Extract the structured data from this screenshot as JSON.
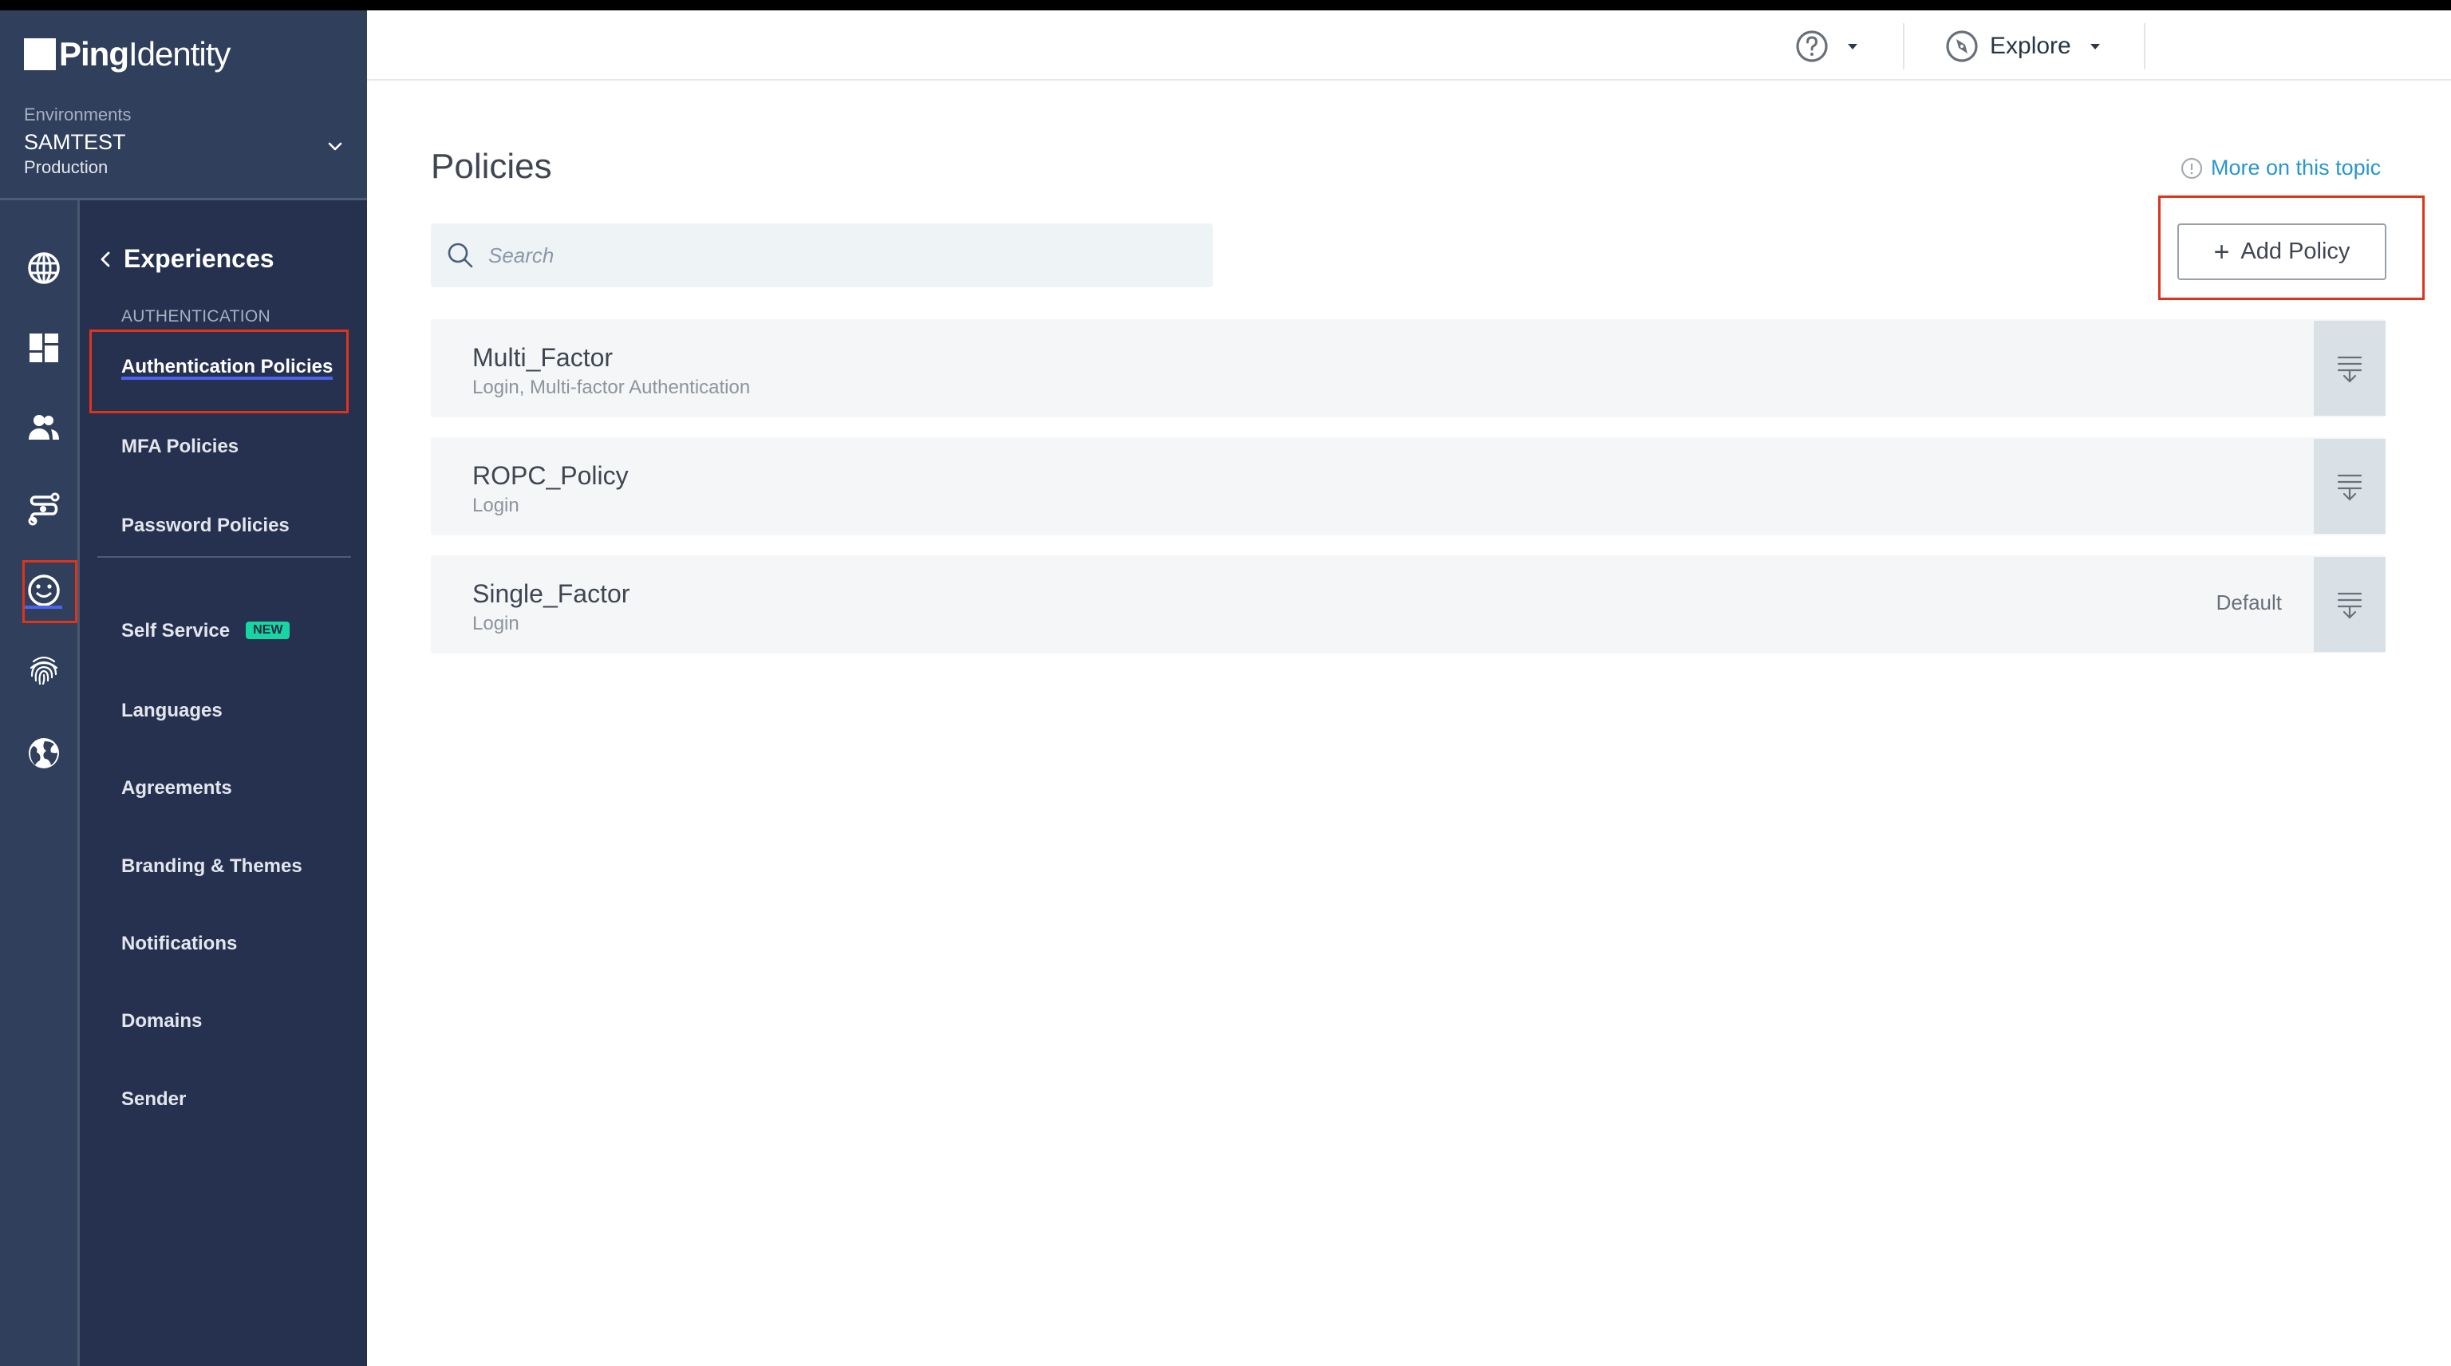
{
  "app": {
    "brand_bold": "Ping",
    "brand_light": "Identity",
    "brand_suffix": "."
  },
  "environment": {
    "label": "Environments",
    "name": "SAMTEST",
    "type": "Production"
  },
  "icon_strip": [
    {
      "name": "globe-icon",
      "label": "Overview"
    },
    {
      "name": "dashboard-icon",
      "label": "Dashboard"
    },
    {
      "name": "users-icon",
      "label": "Identities"
    },
    {
      "name": "connections-icon",
      "label": "Connections"
    },
    {
      "name": "smiley-icon",
      "label": "Experiences",
      "active": true
    },
    {
      "name": "fingerprint-icon",
      "label": "Threat Protection"
    },
    {
      "name": "earth-icon",
      "label": "Settings"
    }
  ],
  "nav": {
    "back_label": "Experiences",
    "section_label": "AUTHENTICATION",
    "items": [
      {
        "label": "Authentication Policies",
        "active": true
      },
      {
        "label": "MFA Policies"
      },
      {
        "label": "Password Policies"
      },
      {
        "label": "Self Service",
        "badge": "NEW"
      },
      {
        "label": "Languages"
      },
      {
        "label": "Agreements"
      },
      {
        "label": "Branding & Themes"
      },
      {
        "label": "Notifications"
      },
      {
        "label": "Domains"
      },
      {
        "label": "Sender"
      }
    ]
  },
  "header": {
    "help_icon": "question-circle-icon",
    "explore_label": "Explore",
    "explore_icon": "compass-icon"
  },
  "main": {
    "title": "Policies",
    "help_link": "More on this topic",
    "search_placeholder": "Search",
    "search_value": "",
    "add_button": "Add Policy",
    "add_button_icon": "+",
    "policies": [
      {
        "name": "Multi_Factor",
        "description": "Login, Multi-factor Authentication",
        "default_label": ""
      },
      {
        "name": "ROPC_Policy",
        "description": "Login",
        "default_label": ""
      },
      {
        "name": "Single_Factor",
        "description": "Login",
        "default_label": "Default"
      }
    ]
  },
  "colors": {
    "sidebar_bg": "#263150",
    "sidebar_head_bg": "#2f3f5c",
    "accent_underline": "#4d63f0",
    "badge_new": "#17d6a1",
    "link": "#2996cc",
    "annotation_red": "#e0341a"
  }
}
